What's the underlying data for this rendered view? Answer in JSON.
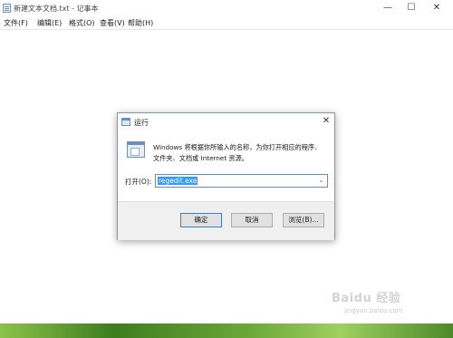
{
  "notepad": {
    "title": "新建文本文档.txt - 记事本",
    "menu": [
      "文件(F)",
      "编辑(E)",
      "格式(O)",
      "查看(V)",
      "帮助(H)"
    ],
    "controls": {
      "minimize": "—",
      "maximize": "☐",
      "close": "✕"
    }
  },
  "run_dialog": {
    "title": "运行",
    "close": "✕",
    "description_line1": "Windows 将根据你所输入的名称，为你打开相应的程序、",
    "description_line2": "文件夹、文档或 Internet 资源。",
    "open_label": "打开(O):",
    "input_value": "regedit.exe",
    "dropdown_icon": "chevron-down-icon",
    "buttons": {
      "ok": "确定",
      "cancel": "取消",
      "browse": "浏览(B)..."
    }
  },
  "watermark": {
    "logo": "Baidu 经验",
    "url": "jingyan.baidu.com"
  }
}
